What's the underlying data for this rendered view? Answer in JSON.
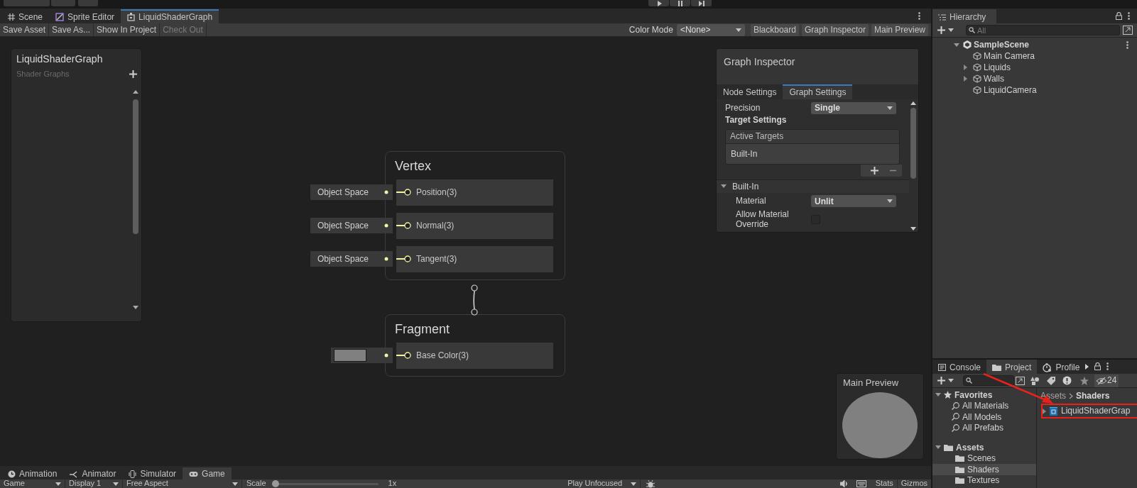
{
  "top_toolbar": {
    "play_controls": [
      {
        "kind": "play"
      },
      {
        "kind": "pause"
      },
      {
        "kind": "step"
      }
    ]
  },
  "editor_tabs": [
    {
      "label": "Scene",
      "kind": "scene",
      "selected": false
    },
    {
      "label": "Sprite Editor",
      "kind": "sprite",
      "selected": false
    },
    {
      "label": "LiquidShaderGraph",
      "kind": "shadergraph",
      "selected": true
    }
  ],
  "graph_toolbar": {
    "buttons": [
      {
        "label": "Save Asset",
        "disabled": false
      },
      {
        "label": "Save As...",
        "disabled": false
      },
      {
        "label": "Show In Project",
        "disabled": false
      },
      {
        "label": "Check Out",
        "disabled": true
      }
    ],
    "color_mode": {
      "label": "Color Mode",
      "value": "<None>"
    },
    "toggles": [
      {
        "label": "Blackboard",
        "on": true
      },
      {
        "label": "Graph Inspector",
        "on": true
      },
      {
        "label": "Main Preview",
        "on": true
      }
    ]
  },
  "blackboard": {
    "title": "LiquidShaderGraph",
    "subtitle": "Shader Graphs"
  },
  "nodes": [
    {
      "title": "Vertex",
      "ports": [
        {
          "label": "Position(3)",
          "input": {
            "kind": "text",
            "label": "Object Space"
          }
        },
        {
          "label": "Normal(3)",
          "input": {
            "kind": "text",
            "label": "Object Space"
          }
        },
        {
          "label": "Tangent(3)",
          "input": {
            "kind": "text",
            "label": "Object Space"
          }
        }
      ]
    },
    {
      "title": "Fragment",
      "ports": [
        {
          "label": "Base Color(3)",
          "input": {
            "kind": "color",
            "color": "#808080"
          }
        }
      ]
    }
  ],
  "graph_inspector": {
    "title": "Graph Inspector",
    "tabs": [
      {
        "label": "Node Settings",
        "selected": false
      },
      {
        "label": "Graph Settings",
        "selected": true
      }
    ],
    "precision": {
      "label": "Precision",
      "value": "Single"
    },
    "target_settings": "Target Settings",
    "active_targets": {
      "header": "Active Targets",
      "items": [
        "Built-In"
      ]
    },
    "section": {
      "title": "Built-In",
      "expanded": true,
      "fields": [
        {
          "kind": "dropdown",
          "label": "Material",
          "value": "Unlit"
        },
        {
          "kind": "checkbox",
          "label": "Allow Material Override",
          "checked": false
        }
      ]
    }
  },
  "main_preview": {
    "title": "Main Preview"
  },
  "bottom_tabs": [
    {
      "label": "Animation",
      "kind": "animation",
      "selected": false
    },
    {
      "label": "Animator",
      "kind": "animator",
      "selected": false
    },
    {
      "label": "Simulator",
      "kind": "simulator",
      "selected": false
    },
    {
      "label": "Game",
      "kind": "game",
      "selected": true
    }
  ],
  "game_toolbar": {
    "view": "Game",
    "display": "Display 1",
    "aspect": "Free Aspect",
    "scale_label": "Scale",
    "scale": {
      "level": 0
    },
    "scale_value": "1x",
    "play_mode": "Play Unfocused",
    "stats": "Stats",
    "gizmos": "Gizmos"
  },
  "hierarchy": {
    "title": "Hierarchy",
    "search_placeholder": "All",
    "scene": {
      "name": "SampleScene",
      "expanded": true,
      "children": [
        {
          "name": "Main Camera",
          "expandable": false
        },
        {
          "name": "Liquids",
          "expandable": true
        },
        {
          "name": "Walls",
          "expandable": true
        },
        {
          "name": "LiquidCamera",
          "expandable": false
        }
      ]
    }
  },
  "project": {
    "tabs": [
      {
        "label": "Console",
        "kind": "console",
        "selected": false
      },
      {
        "label": "Project",
        "kind": "project",
        "selected": true
      },
      {
        "label": "Profile",
        "kind": "profiler",
        "selected": false
      }
    ],
    "hidden_count": "24",
    "favorites": {
      "title": "Favorites",
      "expanded": true,
      "items": [
        "All Materials",
        "All Models",
        "All Prefabs"
      ]
    },
    "assets": {
      "title": "Assets",
      "expanded": true,
      "children": [
        {
          "name": "Scenes",
          "selected": false
        },
        {
          "name": "Shaders",
          "selected": true
        },
        {
          "name": "Textures",
          "selected": false
        }
      ]
    },
    "breadcrumb": [
      "Assets",
      "Shaders"
    ],
    "files": [
      {
        "name": "LiquidShaderGrap",
        "highlighted": true
      }
    ]
  }
}
